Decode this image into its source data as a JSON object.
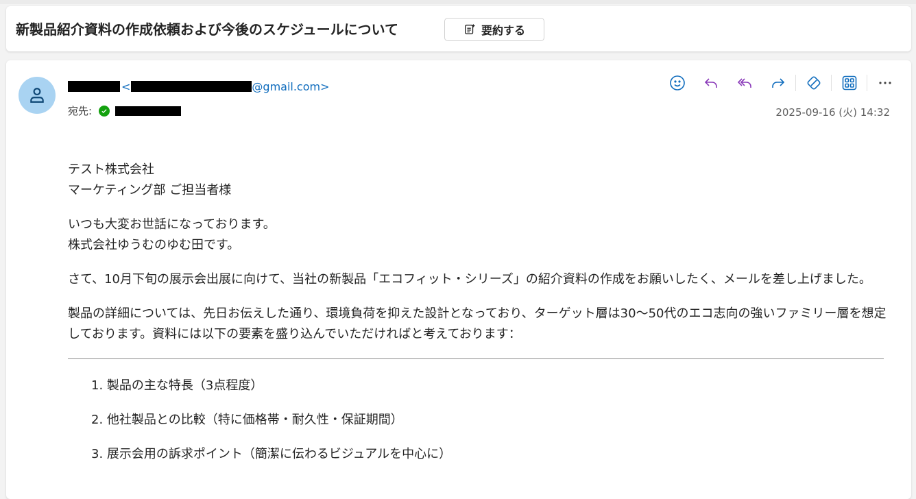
{
  "subject": "新製品紹介資料の作成依頼および今後のスケジュールについて",
  "summarize_label": "要約する",
  "from": {
    "email_domain": "@gmail.com>",
    "lt": "<"
  },
  "to_label": "宛先:",
  "date": "2025-09-16 (火) 14:32",
  "body": {
    "greeting_line1": "テスト株式会社",
    "greeting_line2": "マーケティング部 ご担当者様",
    "intro_line1": "いつも大変お世話になっております。",
    "intro_line2": "株式会社ゆうむのゆむ田です。",
    "para1": "さて、10月下旬の展示会出展に向けて、当社の新製品「エコフィット・シリーズ」の紹介資料の作成をお願いしたく、メールを差し上げました。",
    "para2": "製品の詳細については、先日お伝えした通り、環境負荷を抑えた設計となっており、ターゲット層は30～50代のエコ志向の強いファミリー層を想定しております。資料には以下の要素を盛り込んでいただければと考えております：",
    "list": [
      "1. 製品の主な特長（3点程度）",
      "2. 他社製品との比較（特に価格帯・耐久性・保証期間）",
      "3. 展示会用の訴求ポイント（簡潔に伝わるビジュアルを中心に）"
    ]
  },
  "colors": {
    "accent": "#0f6cbd",
    "avatar_bg": "#a9d3f2",
    "reply_purple": "#8a3ab9"
  }
}
